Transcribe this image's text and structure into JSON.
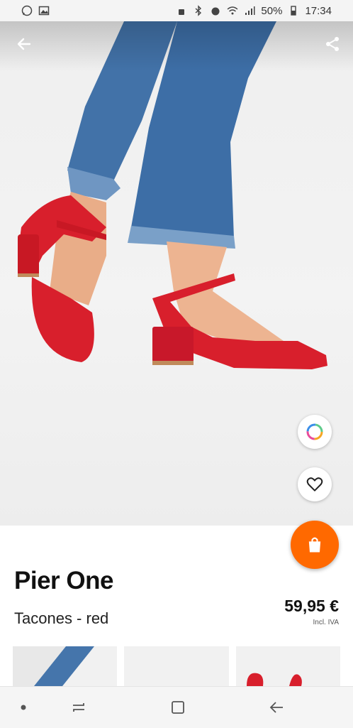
{
  "status_bar": {
    "battery": "50%",
    "time": "17:34"
  },
  "product": {
    "brand": "Pier One",
    "subtitle": "Tacones - red",
    "price": "59,95 €",
    "tax_note": "Incl. IVA"
  },
  "colors": {
    "accent": "#ff6900",
    "shoe_red": "#d8202c",
    "denim": "#3f6fa6"
  },
  "icons": {
    "back": "arrow-left-icon",
    "share": "share-icon",
    "color_picker": "color-ring-icon",
    "wishlist": "heart-icon",
    "cart": "shopping-bag-icon"
  },
  "thumbnails": [
    {
      "name": "jeans-and-shoe"
    },
    {
      "name": "blank"
    },
    {
      "name": "red-shoe-top"
    }
  ]
}
